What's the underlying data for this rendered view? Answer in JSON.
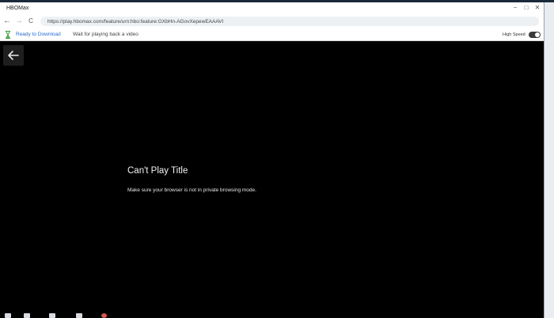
{
  "window": {
    "title": "HBOMax"
  },
  "controls": {
    "minimize": "−",
    "maximize": "□",
    "close": "✕"
  },
  "nav": {
    "back": "←",
    "forward": "→",
    "reload": "C",
    "url": "https://play.hbomax.com/feature/urn:hbo:feature:GXbHn-AGovXepewEAAAVI"
  },
  "infobar": {
    "status": "Ready to Download",
    "message": "Wait for playing back a video",
    "high_speed_label": "High Speed",
    "high_speed_on": true,
    "status_color": "#2b6cc9"
  },
  "player": {
    "error_title": "Can't Play Title",
    "error_message": "Make sure your browser is not in private browsing mode."
  },
  "icons": [
    "hourglass-icon",
    "back-arrow-icon"
  ]
}
